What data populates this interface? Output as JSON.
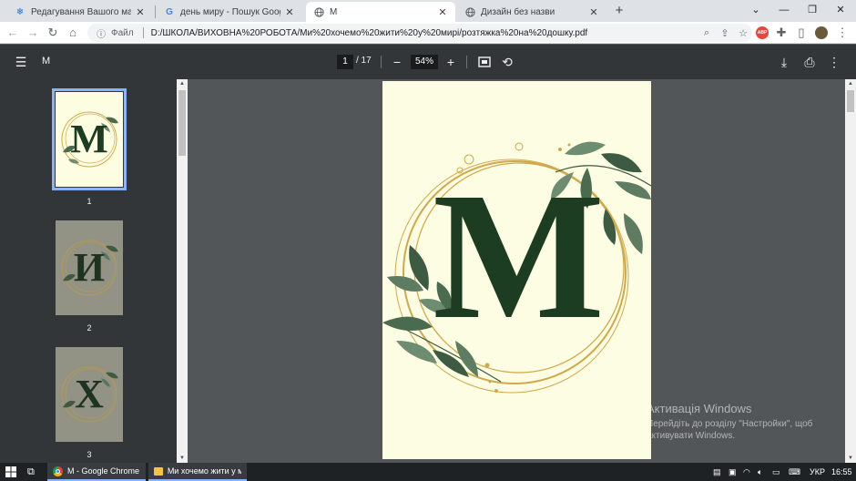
{
  "browser": {
    "tabs": [
      {
        "title": "Редагування Вашого матеріалу",
        "icon": "snowflake-icon",
        "active": false
      },
      {
        "title": "день миру - Пошук Google",
        "icon": "google-g-icon",
        "active": false
      },
      {
        "title": "M",
        "icon": "globe-icon",
        "active": true
      },
      {
        "title": "Дизайн без назви",
        "icon": "globe-icon",
        "active": false
      }
    ],
    "address": {
      "scheme_label": "Файл",
      "url": "D:/ШКОЛА/ВИХОВНА%20РОБОТА/Ми%20хочемо%20жити%20у%20мирі/розтяжка%20на%20дошку.pdf"
    },
    "extension_badge": "ABP"
  },
  "pdf_viewer": {
    "title": "M",
    "current_page": "1",
    "total_pages": "/ 17",
    "zoom": "54%",
    "thumbnails": [
      {
        "number": "1",
        "letter": "M",
        "selected": true
      },
      {
        "number": "2",
        "letter": "И",
        "selected": false
      },
      {
        "number": "3",
        "letter": "Х",
        "selected": false
      }
    ],
    "main_letter": "M"
  },
  "watermark": {
    "line1": "Активація Windows",
    "line2": "Перейдіть до розділу \"Настройки\", щоб",
    "line3": "активувати Windows."
  },
  "taskbar": {
    "apps": [
      {
        "label": "M - Google Chrome",
        "icon": "chrome-icon"
      },
      {
        "label": "Ми хочемо жити у м...",
        "icon": "folder-icon"
      }
    ],
    "language": "УКР",
    "time": "16:55"
  },
  "colors": {
    "letter_green": "#1d3d22",
    "page_cream": "#fdfde3",
    "ring_gold": "#d1a94a",
    "leaf_green": "#4a6b4f"
  }
}
